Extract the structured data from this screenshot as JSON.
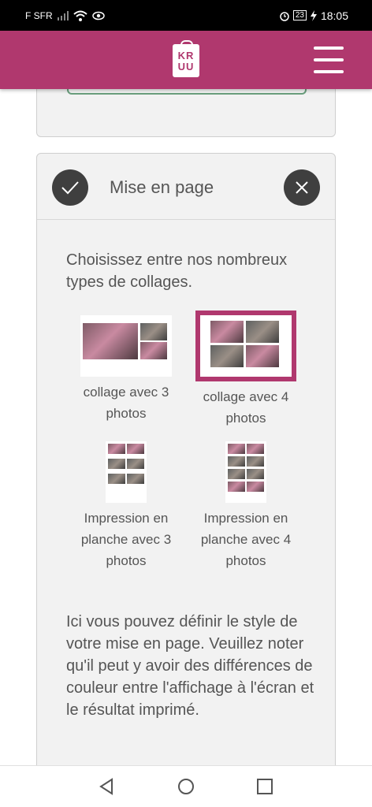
{
  "status_bar": {
    "carrier": "F SFR",
    "battery": "23",
    "time": "18:05"
  },
  "app_bar": {
    "logo_text": "KRUU",
    "menu_icon": "hamburger-icon"
  },
  "section": {
    "title": "Mise en page",
    "confirm_icon": "checkmark-icon",
    "close_icon": "close-icon",
    "intro": "Choisissez entre nos nombreux types de collages.",
    "options": [
      {
        "label": "collage avec 3 photos",
        "selected": false
      },
      {
        "label": "collage avec 4 photos",
        "selected": true
      },
      {
        "label": "Impression en planche avec 3 photos",
        "selected": false
      },
      {
        "label": "Impression en planche avec 4 photos",
        "selected": false
      }
    ],
    "note": "Ici vous pouvez définir le style de votre mise en page. Veuillez noter qu'il peut y avoir des différences de couleur entre l'affichage à l'écran et le résultat imprimé."
  },
  "nav_bar": {
    "back_icon": "back-triangle-icon",
    "home_icon": "home-circle-icon",
    "recents_icon": "recents-square-icon"
  },
  "colors": {
    "brand": "#b0386e",
    "button_dark": "#3f3f3f"
  }
}
